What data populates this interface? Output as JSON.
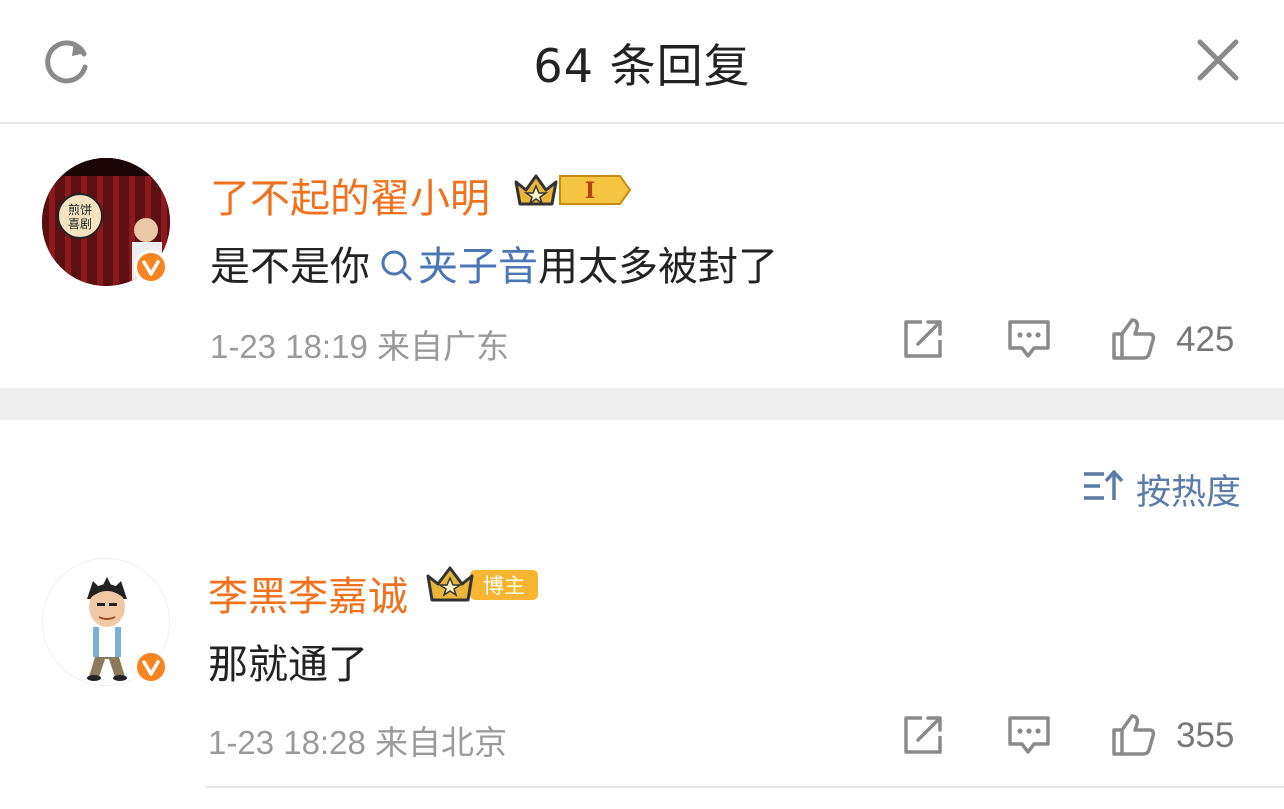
{
  "header": {
    "title": "64 条回复",
    "refresh_icon": "refresh-icon",
    "close_icon": "close-icon"
  },
  "comments": [
    {
      "username": "了不起的翟小明",
      "level_badge": "I",
      "text_before": "是不是你",
      "topic": "夹子音",
      "text_after": "用太多被封了",
      "meta": "1-23 18:19 来自广东",
      "like_count": "425",
      "avatar_sign": "煎饼\n喜剧"
    },
    {
      "username": "李黑李嘉诚",
      "level_badge": "博主",
      "text": "那就通了",
      "meta": "1-23 18:28 来自北京",
      "like_count": "355"
    }
  ],
  "sort": {
    "label": "按热度"
  },
  "colors": {
    "username": "#f2711c",
    "topic": "#4a76b3",
    "meta": "#9a9a9a",
    "verify": "#f7841f"
  }
}
